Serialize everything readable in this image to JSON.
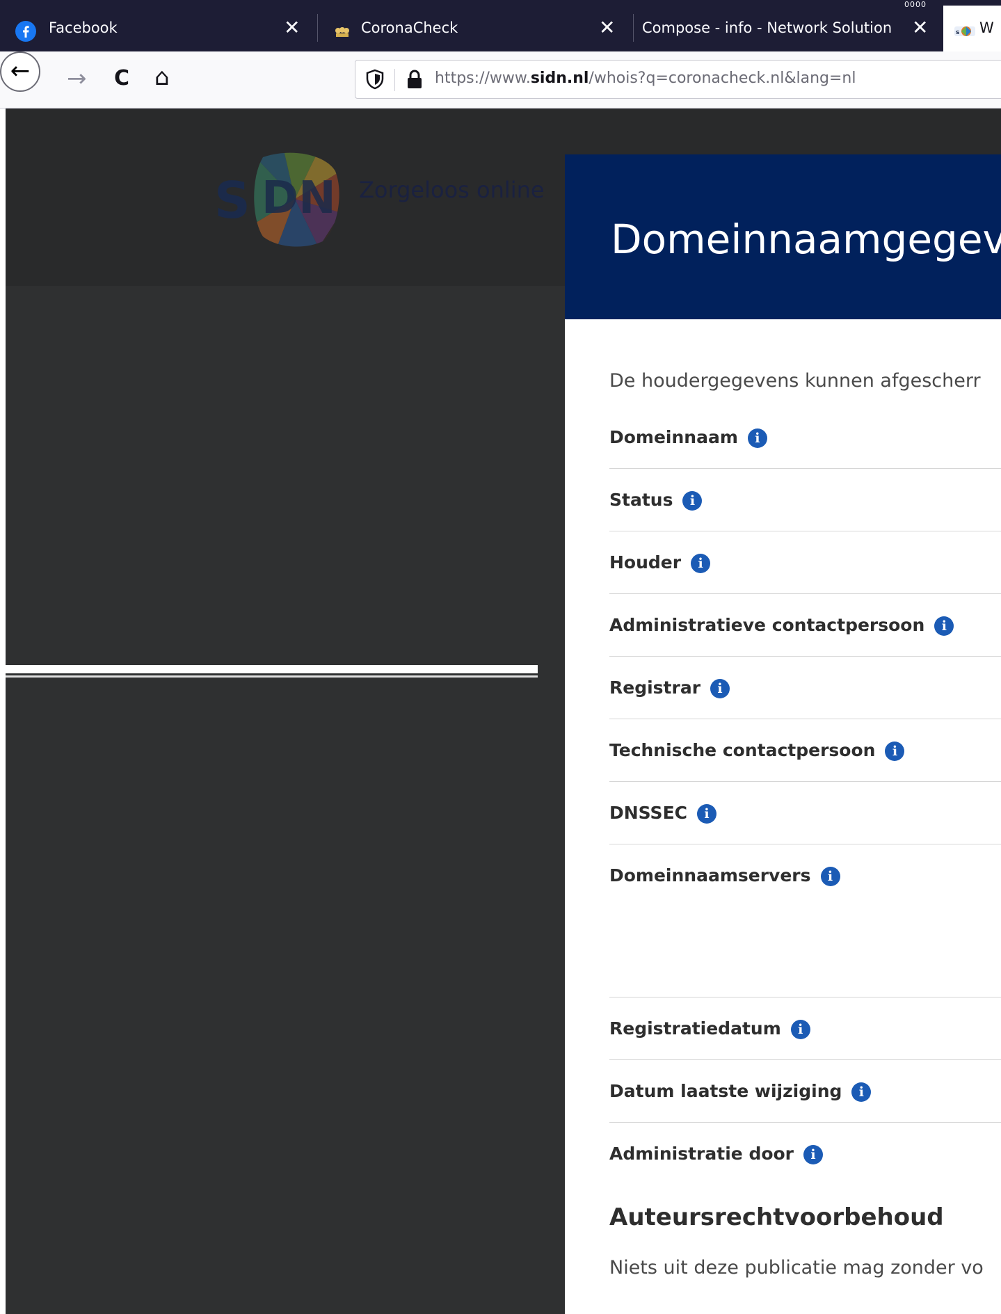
{
  "browser": {
    "top_badge": "0000",
    "tabs": [
      {
        "label": "Facebook",
        "close": "✕"
      },
      {
        "label": "CoronaCheck",
        "close": "✕"
      },
      {
        "label": "Compose - info - Network Solution",
        "close": "✕"
      },
      {
        "label": "W"
      }
    ],
    "nav": {
      "back": "←",
      "forward": "→",
      "reload": "C",
      "home": "⌂"
    },
    "url": {
      "scheme": "https://www.",
      "domain": "sidn.nl",
      "path": "/whois?q=coronacheck.nl&lang=nl"
    }
  },
  "header": {
    "logo_letter": "S",
    "tagline": "Zorgeloos online"
  },
  "card": {
    "title": "Domeinnaamgegev",
    "intro": "De houdergegevens kunnen afgescherr",
    "fields": [
      {
        "label": "Domeinnaam"
      },
      {
        "label": "Status"
      },
      {
        "label": "Houder"
      },
      {
        "label": "Administratieve contactpersoon"
      },
      {
        "label": "Registrar"
      },
      {
        "label": "Technische contactpersoon"
      },
      {
        "label": "DNSSEC"
      },
      {
        "label": "Domeinnaamservers"
      },
      {
        "label": "Registratiedatum"
      },
      {
        "label": "Datum laatste wijziging"
      },
      {
        "label": "Administratie door"
      }
    ],
    "info_glyph": "i",
    "copyright_heading": "Auteursrechtvoorbehoud",
    "copyright_text": "Niets uit deze publicatie mag zonder vo"
  },
  "colors": {
    "tabbar": "#1d1d35",
    "banner": "#01215c",
    "info_icon": "#1b5bb5",
    "page_overlay": "#2f3031"
  }
}
